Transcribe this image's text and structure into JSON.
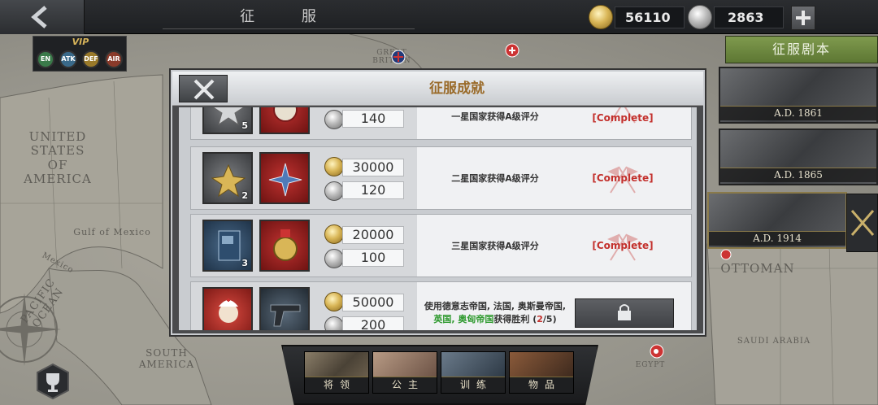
{
  "topbar": {
    "title": "征 服",
    "gold_amount": "56110",
    "silver_amount": "2863",
    "icons": [
      "back-arrow-icon",
      "gold-coin-icon",
      "silver-coin-icon",
      "plus-icon"
    ]
  },
  "vip": {
    "label": "VIP",
    "badges": [
      "EN",
      "ATK",
      "DEF",
      "AIR"
    ]
  },
  "map": {
    "labels": [
      "United States\nof\nAmerica",
      "Gulf of Mexico",
      "Mexico",
      "Pacific Ocean",
      "South\nAmerica",
      "Ottoman",
      "Saudi Arabia",
      "Great\nBritain",
      "Egypt"
    ]
  },
  "right_panel": {
    "button": "征服剧本",
    "eras": [
      "A.D. 1861",
      "A.D. 1865",
      "A.D. 1914"
    ]
  },
  "dialog": {
    "title": "征服成就",
    "rows": [
      {
        "badge_count": "5",
        "gold": "",
        "silver": "140",
        "desc": "一星国家获得A级评分",
        "status": "[Complete]"
      },
      {
        "badge_count": "2",
        "gold": "30000",
        "silver": "120",
        "desc": "二星国家获得A级评分",
        "status": "[Complete]"
      },
      {
        "badge_count": "3",
        "gold": "20000",
        "silver": "100",
        "desc": "三星国家获得A级评分",
        "status": "[Complete]"
      },
      {
        "badge_count": "",
        "gold": "50000",
        "silver": "200",
        "desc_line1": "使用德意志帝国, 法国, 奥斯曼帝国,",
        "desc_green": "英国, 奥匈帝国",
        "desc_mid": "获得胜利 (",
        "desc_progress_current": "2",
        "desc_progress_total": "/5",
        "desc_end": ")",
        "status": ""
      }
    ]
  },
  "dock": {
    "buttons": [
      "将领",
      "公主",
      "训练",
      "物品"
    ]
  },
  "colors": {
    "accent_gold": "#9a6b2a",
    "complete_red": "#c3302c",
    "green_text": "#2f9a2f",
    "playbook_green": "#6d8940"
  }
}
